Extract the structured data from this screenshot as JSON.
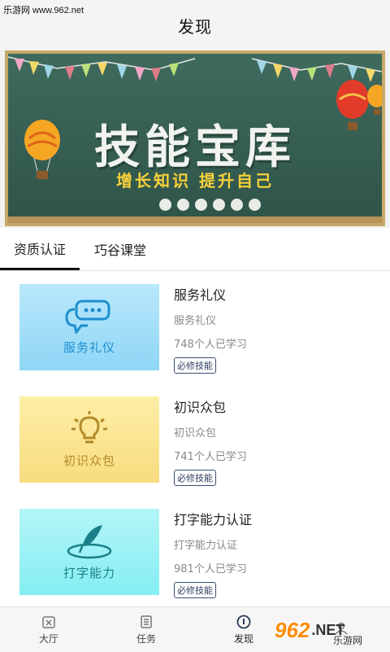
{
  "watermark_top": "乐游网 www.962.net",
  "header": {
    "title": "发现"
  },
  "banner": {
    "title": "技能宝库",
    "subtitle": "增长知识  提升自己"
  },
  "tabs": [
    {
      "label": "资质认证",
      "active": true
    },
    {
      "label": "巧谷课堂",
      "active": false
    }
  ],
  "courses": [
    {
      "thumb_label": "服务礼仪",
      "title": "服务礼仪",
      "subtitle": "服务礼仪",
      "learners": "748个人已学习",
      "tag": "必修技能",
      "icon": "chat-bubbles-icon",
      "color": "#1e8fd0"
    },
    {
      "thumb_label": "初识众包",
      "title": "初识众包",
      "subtitle": "初识众包",
      "learners": "741个人已学习",
      "tag": "必修技能",
      "icon": "lightbulb-icon",
      "color": "#b48a2a"
    },
    {
      "thumb_label": "打字能力",
      "title": "打字能力认证",
      "subtitle": "打字能力认证",
      "learners": "981个人已学习",
      "tag": "必修技能",
      "icon": "quill-icon",
      "color": "#1a7f86"
    }
  ],
  "bottom_nav": [
    {
      "label": "大厅",
      "icon": "hall-icon",
      "active": false
    },
    {
      "label": "任务",
      "icon": "task-icon",
      "active": false
    },
    {
      "label": "发现",
      "icon": "discover-icon",
      "active": true
    },
    {
      "label": "",
      "icon": "profile-icon",
      "active": false
    }
  ],
  "watermark_logo": {
    "number": "962",
    "suffix": ".NET",
    "site": "乐游网"
  }
}
